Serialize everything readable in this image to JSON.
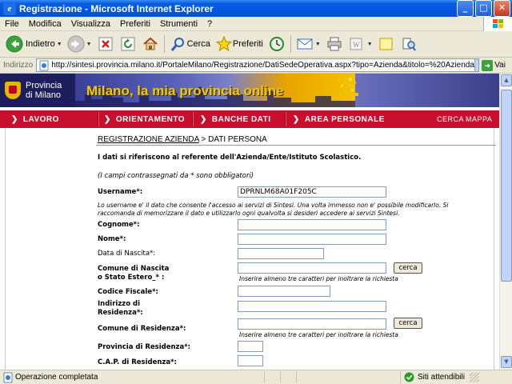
{
  "window": {
    "title": "Registrazione - Microsoft Internet Explorer"
  },
  "menu": [
    "File",
    "Modifica",
    "Visualizza",
    "Preferiti",
    "Strumenti",
    "?"
  ],
  "toolbar": {
    "back_label": "Indietro",
    "search_label": "Cerca",
    "favorites_label": "Preferiti"
  },
  "address": {
    "label": "Indirizzo",
    "url": "http://sintesi.provincia.milano.it/PortaleMilano/Registrazione/DatiSedeOperativa.aspx?tipo=Azienda&titolo=%20Azienda",
    "go_label": "Vai"
  },
  "site": {
    "org_line1": "Provincia",
    "org_line2": "di Milano",
    "tagline": "Milano, la mia provincia online",
    "nav": [
      "LAVORO",
      "ORIENTAMENTO",
      "BANCHE DATI",
      "AREA PERSONALE"
    ],
    "nav_util": [
      "CERCA",
      "MAPPA"
    ]
  },
  "breadcrumb": {
    "link": "REGISTRAZIONE AZIENDA",
    "sep": " > ",
    "current": "DATI PERSONA"
  },
  "form": {
    "intro": "I dati si riferiscono al referente dell'Azienda/Ente/Istituto Scolastico.",
    "required_note": "(I campi contrassegnati da * sono obbligatori)",
    "username_label": "Username*:",
    "username_value": "DPRNLM68A01F205C",
    "username_help_1": "Lo username e' il dato che consente l'accesso ai servizi di Sintesi. Una volta immesso non e' possibile modificarlo. Si",
    "username_help_2": "raccomanda di memorizzare il dato e utilizzarlo ogni qualvolta si desideri accedere ai servizi Sintesi.",
    "cognome_label": "Cognome*:",
    "nome_label": "Nome*:",
    "data_nascita_label": "Data di Nascita*:",
    "comune_nascita_label_1": "Comune di Nascita",
    "comune_nascita_label_2": "o Stato Estero_* :",
    "cerca_label": "cerca",
    "min_chars_hint": "Inserire almeno tre caratteri per inoltrare la richiesta",
    "codice_fiscale_label": "Codice Fiscale*:",
    "indirizzo_label_1": "Indirizzo di",
    "indirizzo_label_2": "Residenza*:",
    "comune_residenza_label": "Comune di Residenza*:",
    "provincia_label": "Provincia di Residenza*:",
    "cap_label": "C.A.P. di Residenza*:"
  },
  "status": {
    "text": "Operazione completata",
    "zone": "Siti attendibili"
  }
}
